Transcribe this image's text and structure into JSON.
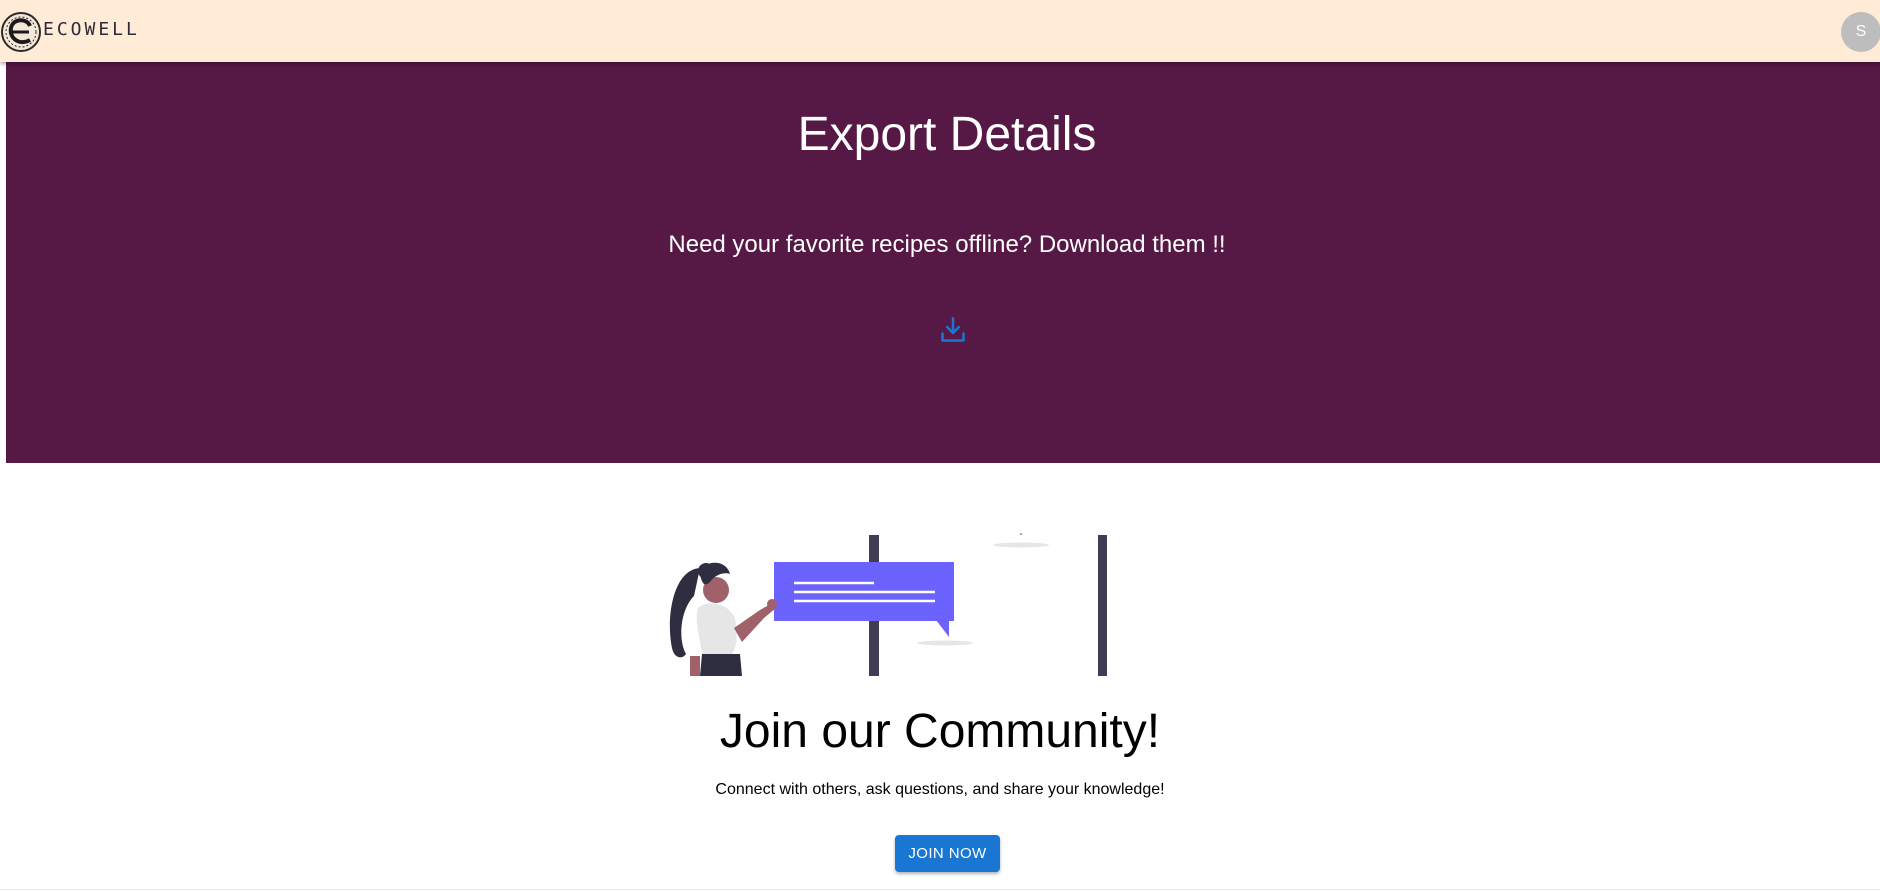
{
  "header": {
    "brand": "ECOWELL",
    "avatar_initial": "S"
  },
  "export": {
    "title": "Export Details",
    "subtitle": "Need your favorite recipes offline? Download them !!",
    "download_icon": "download-icon"
  },
  "community": {
    "title": "Join our Community!",
    "subtitle": "Connect with others, ask questions, and share your knowledge!",
    "join_label": "JOIN NOW"
  },
  "colors": {
    "header_bg": "#ffebd6",
    "export_bg": "#561844",
    "accent": "#1976d2",
    "illustration_purple": "#6c63ff"
  }
}
